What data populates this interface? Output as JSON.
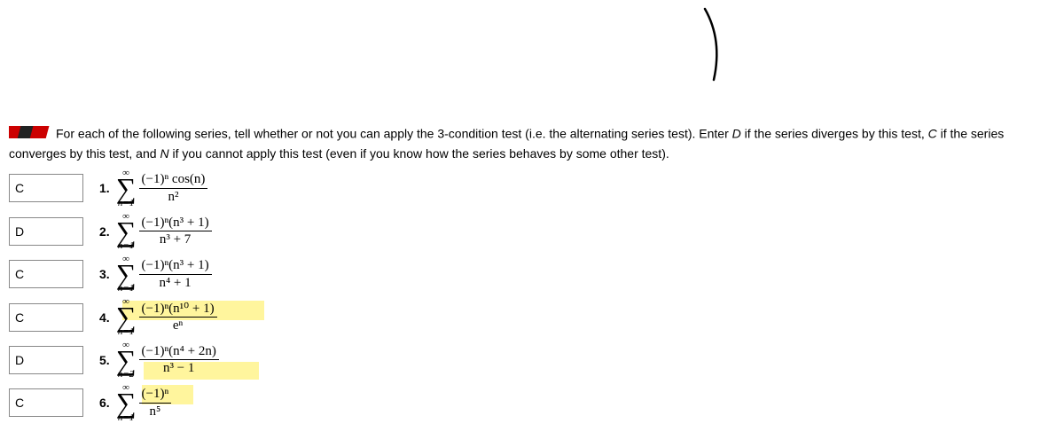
{
  "instructions": {
    "text1": "For each of the following series, tell whether or not you can apply the 3-condition test (i.e. the alternating series test). Enter ",
    "d_key": "D",
    "text2": " if the series diverges by this test, ",
    "c_key": "C",
    "text3": " if the series converges by this test, and ",
    "n_key": "N",
    "text4": " if you cannot apply this test (even if you know how the series behaves by some other test)."
  },
  "problems": [
    {
      "answer": "C",
      "number": "1.",
      "lower": "n=1",
      "upper": "∞",
      "numerator": "(−1)ⁿ cos(n)",
      "denominator": "n²"
    },
    {
      "answer": "D",
      "number": "2.",
      "lower": "n=1",
      "upper": "∞",
      "numerator": "(−1)ⁿ(n³ + 1)",
      "denominator": "n³ + 7"
    },
    {
      "answer": "C",
      "number": "3.",
      "lower": "n=1",
      "upper": "∞",
      "numerator": "(−1)ⁿ(n³ + 1)",
      "denominator": "n⁴ + 1"
    },
    {
      "answer": "C",
      "number": "4.",
      "lower": "n=1",
      "upper": "∞",
      "numerator": "(−1)ⁿ(n¹⁰ + 1)",
      "denominator": "eⁿ"
    },
    {
      "answer": "D",
      "number": "5.",
      "lower": "n=2",
      "upper": "∞",
      "numerator": "(−1)ⁿ(n⁴ + 2n)",
      "denominator": "n³ − 1"
    },
    {
      "answer": "C",
      "number": "6.",
      "lower": "n=1",
      "upper": "∞",
      "numerator": "(−1)ⁿ",
      "denominator": "n⁵"
    }
  ]
}
